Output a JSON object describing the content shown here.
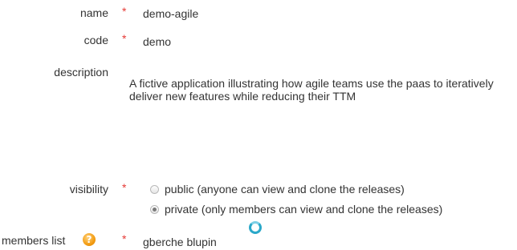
{
  "form": {
    "name": {
      "label": "name",
      "required": "*",
      "value": "demo-agile"
    },
    "code": {
      "label": "code",
      "required": "*",
      "value": "demo"
    },
    "description": {
      "label": "description",
      "value": "A fictive application illustrating how agile teams use the paas to iteratively deliver new features while reducing their TTM"
    },
    "visibility": {
      "label": "visibility",
      "required": "*",
      "options": [
        {
          "label": "public (anyone can view and clone the releases)",
          "checked": false
        },
        {
          "label": "private (only members can view and clone the releases)",
          "checked": true
        }
      ]
    },
    "members": {
      "label": "members list",
      "required": "*",
      "value": "gberche blupin",
      "help_icon_glyph": "?",
      "help_icon": "help-icon",
      "loading_icon": "loading-spinner-icon"
    }
  },
  "colors": {
    "required": "#e53935",
    "help_icon": "#f39c12",
    "spinner": "#2aa8c9"
  }
}
